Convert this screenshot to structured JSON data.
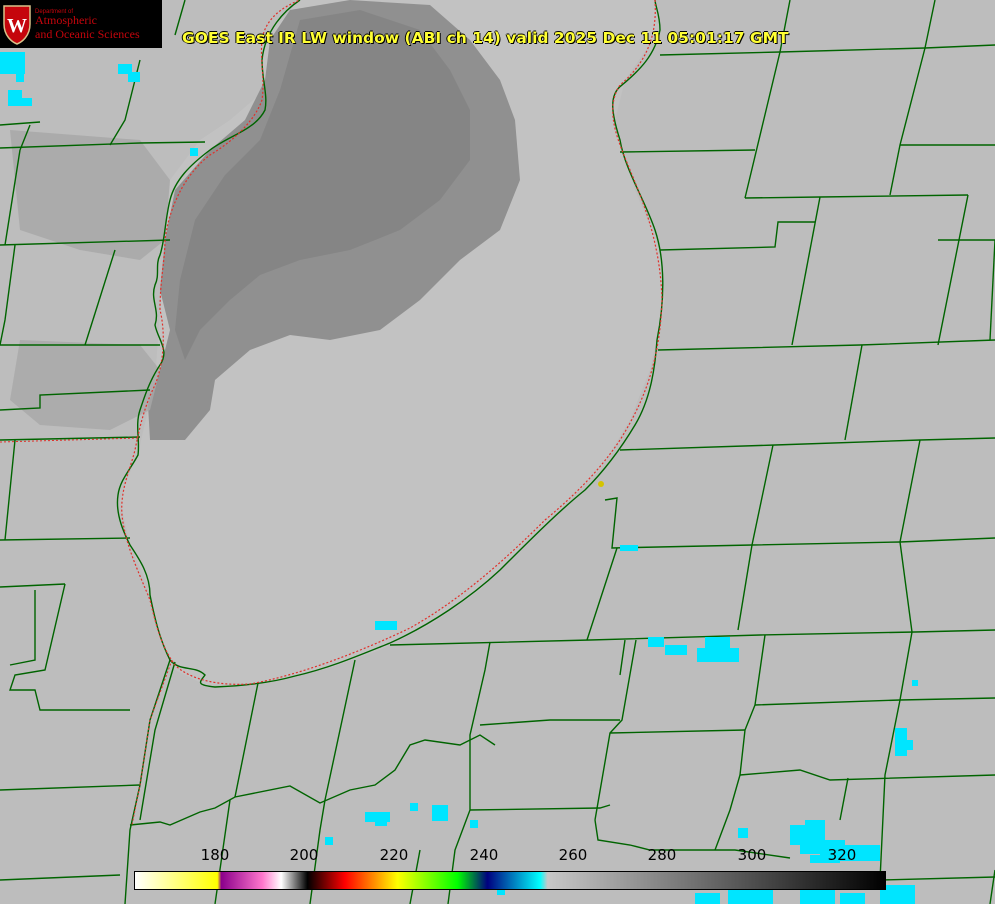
{
  "title": "GOES East IR LW window (ABI ch 14) valid 2025 Dec 11 05:01:17 GMT",
  "logo": {
    "department_line": "Department of",
    "name_line1": "Atmospheric",
    "name_line2": "and Oceanic Sciences",
    "seal_letter": "W"
  },
  "colorbar": {
    "tick_labels": [
      "180",
      "200",
      "220",
      "240",
      "260",
      "280",
      "300",
      "320"
    ],
    "stops": [
      "#ffffff",
      "#ffff00",
      "#8b008b",
      "#ff77cc",
      "#ffffff",
      "#000000",
      "#ff0000",
      "#ffff00",
      "#00ff00",
      "#000080",
      "#00ffff",
      "#c8c8c8",
      "#000000"
    ]
  },
  "colors": {
    "background": "#bdbdbd",
    "cloud": "#8e8e8e",
    "boundary": "#006400",
    "shoreline_dotted": "#e0302a",
    "cold_highlight": "#00e5ff",
    "station_marker": "#d4c400"
  }
}
